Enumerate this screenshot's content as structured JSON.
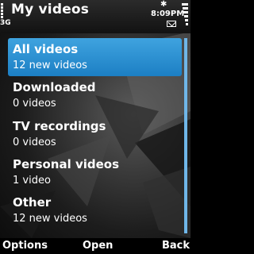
{
  "status_bar": {
    "network": "3G",
    "time": "8:09PM"
  },
  "title": "My videos",
  "list": [
    {
      "title": "All videos",
      "subtitle": "12 new videos",
      "selected": true
    },
    {
      "title": "Downloaded",
      "subtitle": "0 videos",
      "selected": false
    },
    {
      "title": "TV recordings",
      "subtitle": "0 videos",
      "selected": false
    },
    {
      "title": "Personal videos",
      "subtitle": "1 video",
      "selected": false
    },
    {
      "title": "Other",
      "subtitle": "12 new videos",
      "selected": false
    }
  ],
  "softkeys": {
    "left": "Options",
    "middle": "Open",
    "right": "Back"
  },
  "colors": {
    "selection": "#2b8fd3",
    "scrollbar": "#6fb6e8"
  }
}
